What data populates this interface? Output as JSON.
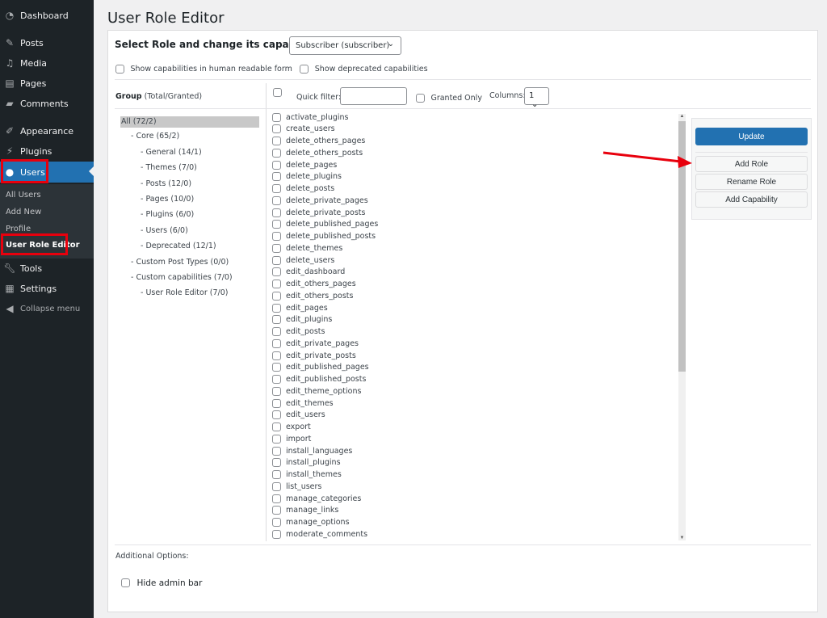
{
  "sidebar": {
    "items": [
      {
        "label": "Dashboard",
        "icon": "dashboard-icon"
      },
      {
        "label": "Posts",
        "icon": "pin-icon"
      },
      {
        "label": "Media",
        "icon": "media-icon"
      },
      {
        "label": "Pages",
        "icon": "pages-icon"
      },
      {
        "label": "Comments",
        "icon": "comment-icon"
      },
      {
        "label": "Appearance",
        "icon": "brush-icon"
      },
      {
        "label": "Plugins",
        "icon": "plugin-icon"
      },
      {
        "label": "Users",
        "icon": "user-icon",
        "active": true
      },
      {
        "label": "Tools",
        "icon": "wrench-icon"
      },
      {
        "label": "Settings",
        "icon": "settings-icon"
      }
    ],
    "submenu": [
      "All Users",
      "Add New",
      "Profile",
      "User Role Editor"
    ],
    "collapse_label": "Collapse menu"
  },
  "page": {
    "title": "User Role Editor",
    "select_role_label": "Select Role and change its capabilities:",
    "selected_role": "Subscriber (subscriber)",
    "show_human_readable": "Show capabilities in human readable form",
    "show_deprecated": "Show deprecated capabilities",
    "group_header_bold": "Group",
    "group_header_rest": "(Total/Granted)",
    "quick_filter_label": "Quick filter:",
    "quick_filter_value": "",
    "granted_only_label": "Granted Only",
    "columns_label": "Columns:",
    "columns_value": "1",
    "additional_options_label": "Additional Options:",
    "hide_admin_bar_label": "Hide admin bar"
  },
  "groups": [
    {
      "label": "All (72/2)",
      "level": 0,
      "selected": true
    },
    {
      "label": "- Core (65/2)",
      "level": 1
    },
    {
      "label": "- General (14/1)",
      "level": 2
    },
    {
      "label": "- Themes (7/0)",
      "level": 2
    },
    {
      "label": "- Posts (12/0)",
      "level": 2
    },
    {
      "label": "- Pages (10/0)",
      "level": 2
    },
    {
      "label": "- Plugins (6/0)",
      "level": 2
    },
    {
      "label": "- Users (6/0)",
      "level": 2
    },
    {
      "label": "- Deprecated (12/1)",
      "level": 2
    },
    {
      "label": "- Custom Post Types (0/0)",
      "level": 1
    },
    {
      "label": "- Custom capabilities (7/0)",
      "level": 1
    },
    {
      "label": "- User Role Editor (7/0)",
      "level": 2
    }
  ],
  "capabilities": [
    "activate_plugins",
    "create_users",
    "delete_others_pages",
    "delete_others_posts",
    "delete_pages",
    "delete_plugins",
    "delete_posts",
    "delete_private_pages",
    "delete_private_posts",
    "delete_published_pages",
    "delete_published_posts",
    "delete_themes",
    "delete_users",
    "edit_dashboard",
    "edit_others_pages",
    "edit_others_posts",
    "edit_pages",
    "edit_plugins",
    "edit_posts",
    "edit_private_pages",
    "edit_private_posts",
    "edit_published_pages",
    "edit_published_posts",
    "edit_theme_options",
    "edit_themes",
    "edit_users",
    "export",
    "import",
    "install_languages",
    "install_plugins",
    "install_themes",
    "list_users",
    "manage_categories",
    "manage_links",
    "manage_options",
    "moderate_comments"
  ],
  "actions": {
    "update": "Update",
    "add_role": "Add Role",
    "rename_role": "Rename Role",
    "add_capability": "Add Capability"
  },
  "colors": {
    "accent": "#2271b1",
    "sidebar_bg": "#1d2327",
    "highlight_box": "#e8000d",
    "annotation_arrow": "#e8000d"
  }
}
